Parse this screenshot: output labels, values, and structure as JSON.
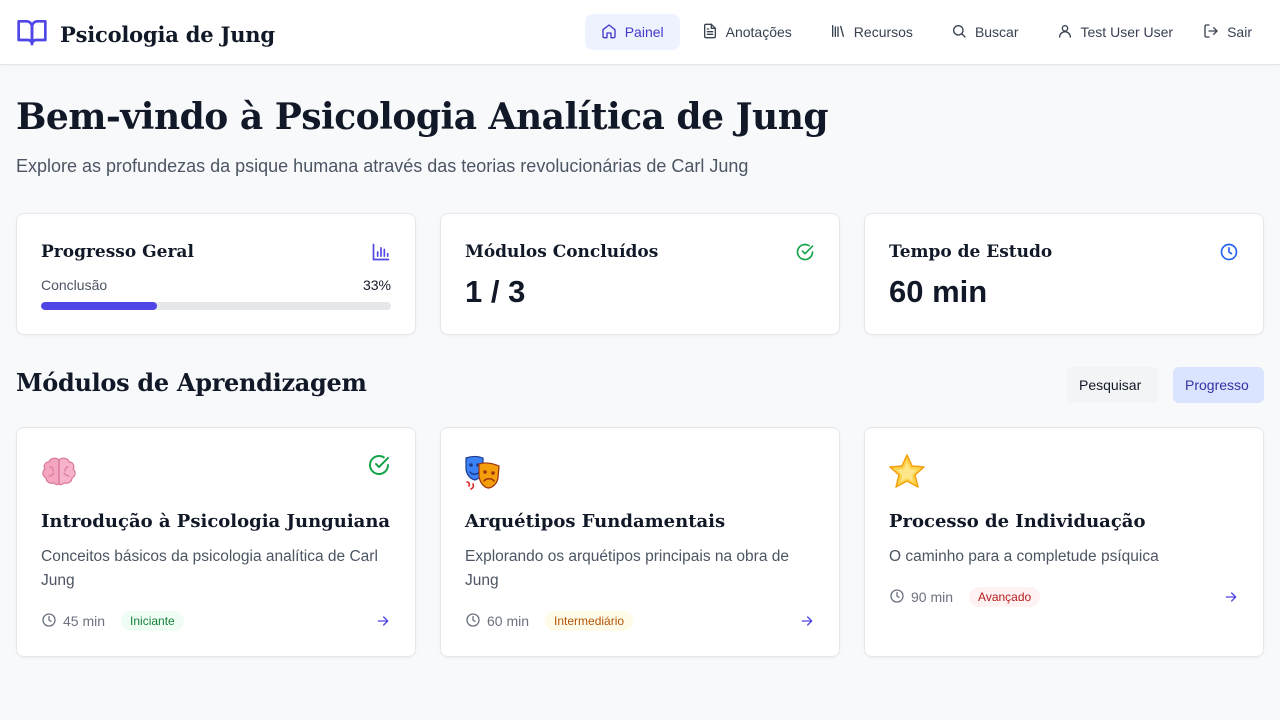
{
  "header": {
    "brand": "Psicologia de Jung",
    "nav": {
      "panel": "Painel",
      "notes": "Anotações",
      "resources": "Recursos",
      "search": "Buscar",
      "user": "Test User User",
      "exit": "Sair"
    },
    "active_item": "Painel"
  },
  "hero": {
    "title": "Bem-vindo à Psicologia Analítica de Jung",
    "subtitle": "Explore as profundezas da psique humana através das teorias revolucionárias de Carl Jung"
  },
  "stats": {
    "progress": {
      "title": "Progresso Geral",
      "label": "Conclusão",
      "percent_text": "33%",
      "percent": 33
    },
    "modules": {
      "title": "Módulos Concluídos",
      "value": "1 / 3"
    },
    "time": {
      "title": "Tempo de Estudo",
      "value": "60 min"
    }
  },
  "modules_section": {
    "title": "Módulos de Aprendizagem",
    "search_button": "Pesquisar",
    "progress_button": "Progresso"
  },
  "modules": [
    {
      "icon": "brain-icon",
      "title": "Introdução à Psicologia Junguiana",
      "description": "Conceitos básicos da psicologia analítica de Carl Jung",
      "duration": "45 min",
      "level": "Iniciante",
      "completed": true
    },
    {
      "icon": "theater-masks-icon",
      "title": "Arquétipos Fundamentais",
      "description": "Explorando os arquétipos principais na obra de Jung",
      "duration": "60 min",
      "level": "Intermediário",
      "completed": false
    },
    {
      "icon": "star-icon",
      "title": "Processo de Individuação",
      "description": "O caminho para a completude psíquica",
      "duration": "90 min",
      "level": "Avançado",
      "completed": false
    }
  ],
  "colors": {
    "accent": "#4f46e5",
    "success": "#16a34a",
    "info": "#2563eb",
    "level_easy": "#15803d",
    "level_mid": "#b45309",
    "level_hard": "#b91c1c"
  }
}
